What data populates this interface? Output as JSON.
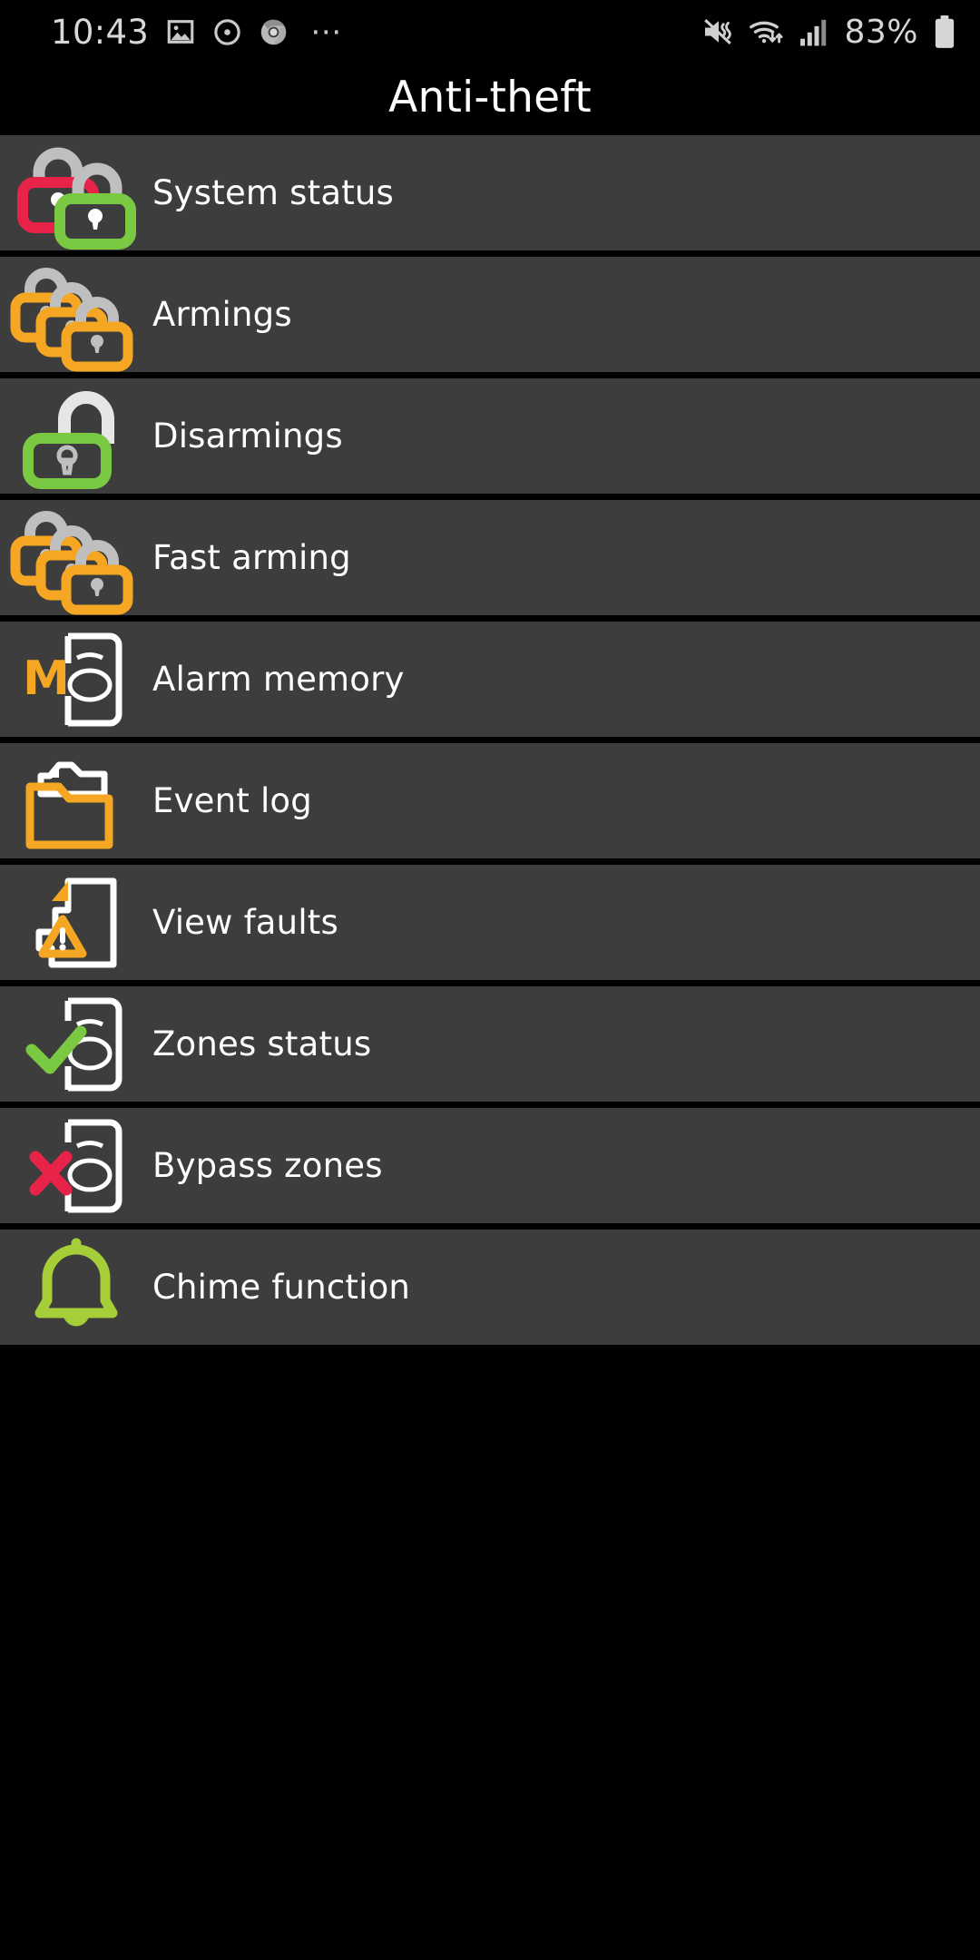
{
  "statusbar": {
    "clock": "10:43",
    "left_icons": [
      "gallery-icon",
      "screen-record-icon",
      "chrome-icon",
      "more-dots-icon"
    ],
    "battery_percent": "83%",
    "right_icons": [
      "mute-vibrate-icon",
      "wifi-icon",
      "cellular-signal-icon",
      "battery-icon"
    ]
  },
  "header": {
    "title": "Anti-theft"
  },
  "colors": {
    "card_bg": "#3d3d3d",
    "page_bg": "#000000",
    "text": "#ffffff",
    "red": "#e8234a",
    "green": "#7ac943",
    "orange": "#f5a623",
    "gray_metal": "#bfbfbf",
    "chime_green": "#a6ce39"
  },
  "menu": {
    "items": [
      {
        "label": "System status",
        "icon": "padlock-pair-red-green-icon"
      },
      {
        "label": "Armings",
        "icon": "triple-padlock-closed-orange-icon"
      },
      {
        "label": "Disarmings",
        "icon": "padlock-open-green-icon"
      },
      {
        "label": "Fast arming",
        "icon": "triple-padlock-closed-orange-icon"
      },
      {
        "label": "Alarm memory",
        "icon": "door-memory-m-icon"
      },
      {
        "label": "Event log",
        "icon": "folder-documents-icon"
      },
      {
        "label": "View faults",
        "icon": "document-warning-icon"
      },
      {
        "label": "Zones status",
        "icon": "door-check-icon"
      },
      {
        "label": "Bypass zones",
        "icon": "door-cross-icon"
      },
      {
        "label": "Chime function",
        "icon": "bell-icon"
      }
    ]
  }
}
